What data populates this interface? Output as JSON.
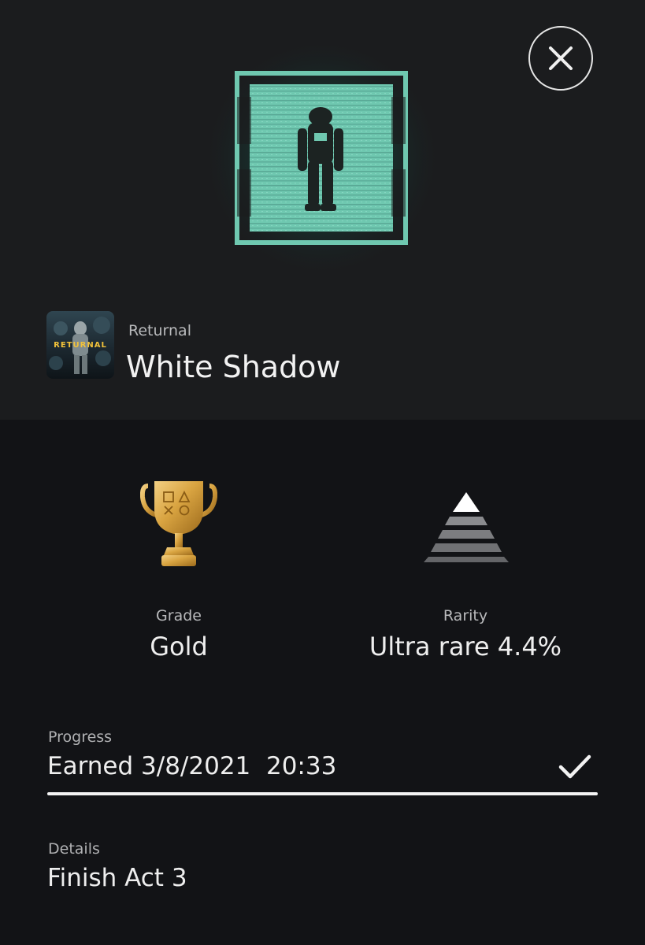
{
  "trophy": {
    "game_name": "Returnal",
    "name": "White Shadow",
    "grade_label": "Grade",
    "grade_value": "Gold",
    "rarity_label": "Rarity",
    "rarity_value": "Ultra rare 4.4%",
    "progress_label": "Progress",
    "progress_value": "Earned 3/8/2021  20:33",
    "progress_fraction": 1.0,
    "details_label": "Details",
    "details_value": "Finish Act 3"
  },
  "game_icon": {
    "logo_text": "RETURNAL"
  },
  "trophy_art_icon": "astronaut-silhouette-icon",
  "grade_icon": "gold-trophy-icon",
  "rarity_icon": "rarity-pyramid-icon",
  "colors": {
    "background": "#121316",
    "header_background": "#1b1c1e",
    "trophy_art_glow": "#6fc8b0",
    "gold": "#d9a441",
    "text_primary": "#eeeeee",
    "text_secondary": "#b9babc"
  }
}
